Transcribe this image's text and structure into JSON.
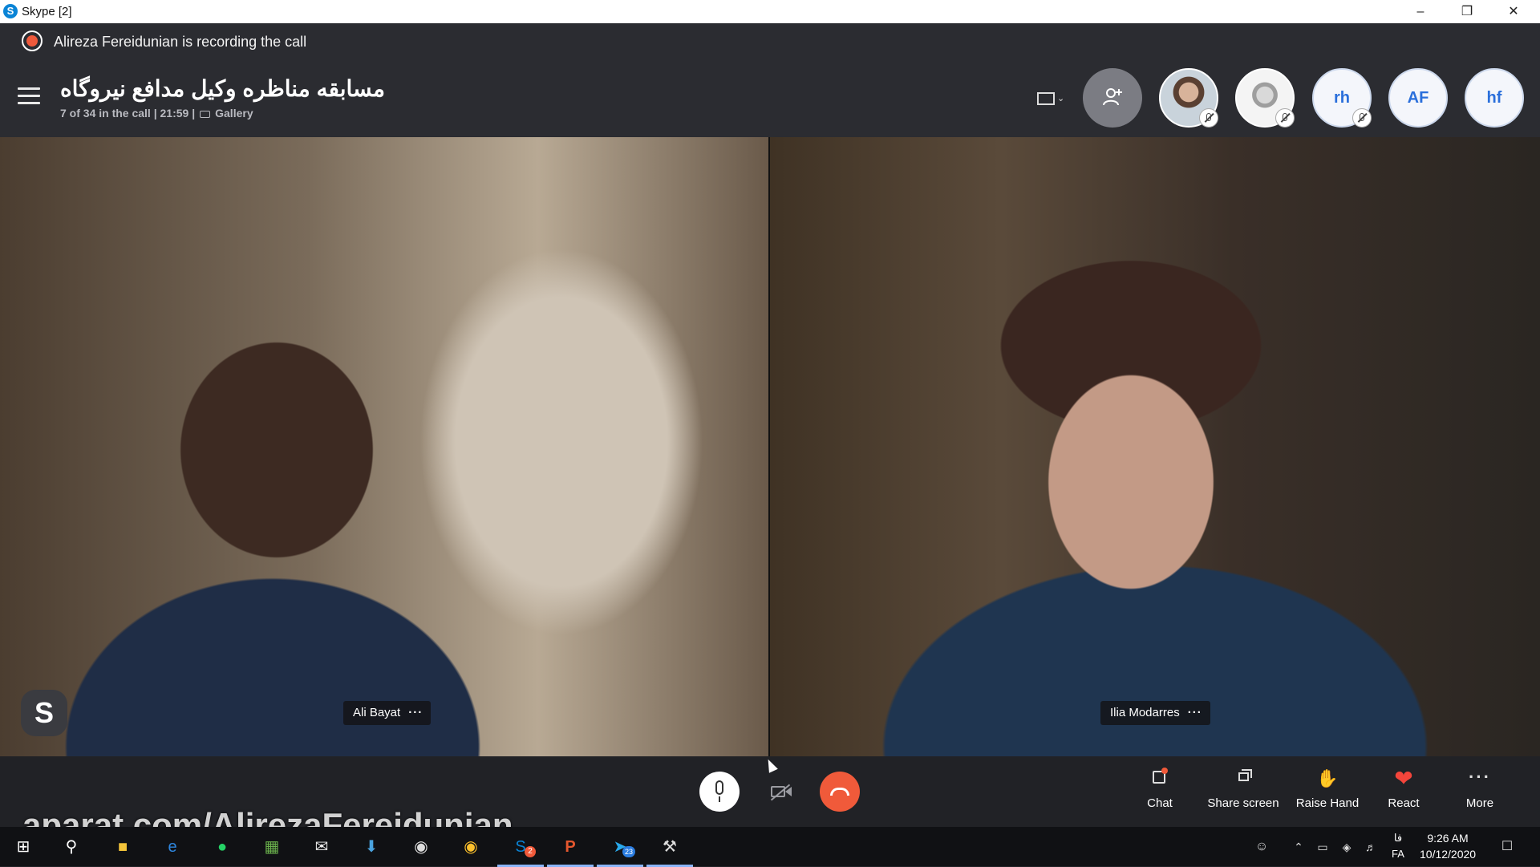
{
  "window": {
    "title": "Skype [2]",
    "app_icon": "S"
  },
  "recording": {
    "text": "Alireza Fereidunian is recording the call"
  },
  "call": {
    "title": "مسابقه مناظره وکیل مدافع نیروگاه",
    "meta_prefix": "7 of 34 in the call | 21:59 |",
    "view_mode": "Gallery"
  },
  "participants_bar": {
    "initials": [
      "rh",
      "AF",
      "hf"
    ]
  },
  "videos": {
    "left_name": "Ali Bayat",
    "right_name": "Ilia Modarres",
    "menu_dots": "···",
    "skype_badge": "S"
  },
  "actions": {
    "chat": "Chat",
    "share": "Share screen",
    "raise": "Raise Hand",
    "react": "React",
    "more": "More"
  },
  "watermark": "aparat.com/AlirezaFereidunian",
  "taskbar": {
    "lang_top": "فا",
    "lang_bottom": "FA",
    "time": "9:26 AM",
    "date": "10/12/2020",
    "skype_badge": "2",
    "telegram_badge": "23"
  },
  "colors": {
    "accent": "#f05a3a",
    "background": "#212226",
    "initials": "#2a6fdb"
  }
}
